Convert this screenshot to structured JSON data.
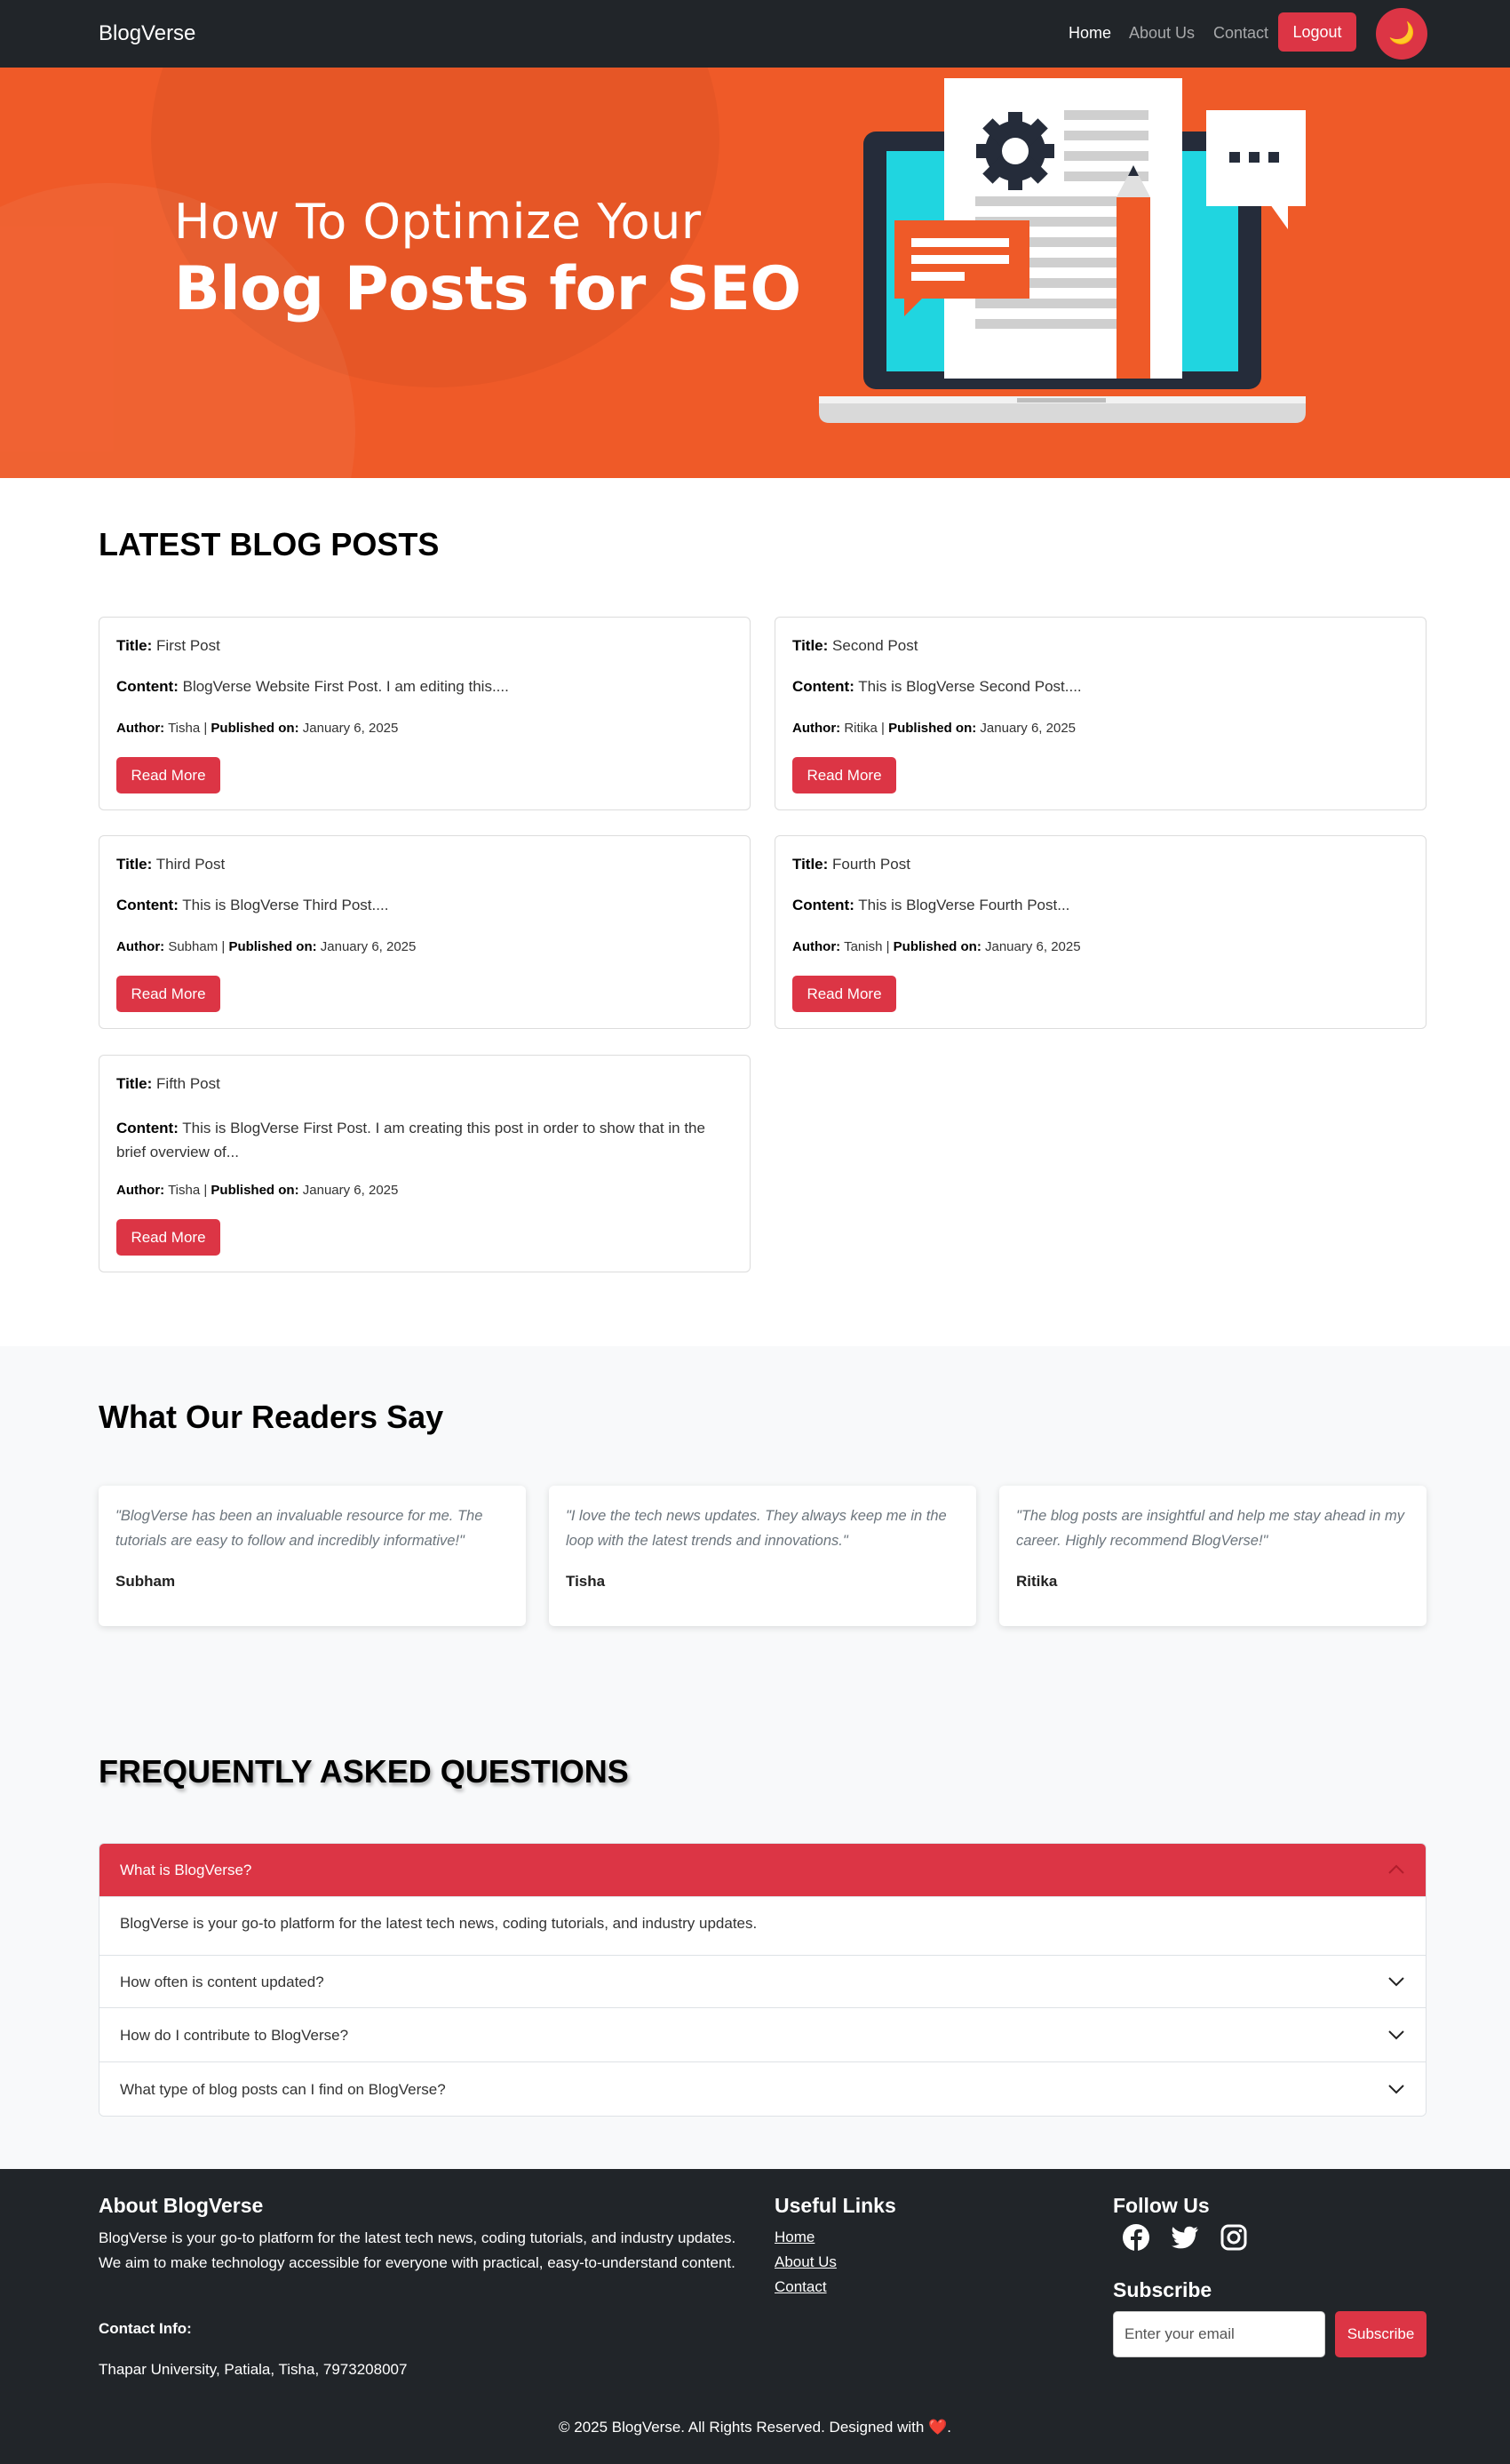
{
  "nav": {
    "brand": "BlogVerse",
    "links": [
      {
        "label": "Home",
        "active": true
      },
      {
        "label": "About Us",
        "active": false
      },
      {
        "label": "Contact",
        "active": false
      }
    ],
    "logout_label": "Logout",
    "theme_icon": "🌙"
  },
  "hero": {
    "line1": "How To Optimize Your",
    "line2": "Blog Posts for SEO"
  },
  "posts": {
    "heading": "LATEST BLOG POSTS",
    "title_label": "Title:",
    "content_label": "Content:",
    "author_label": "Author:",
    "published_label": "Published on:",
    "read_more": "Read More",
    "items": [
      {
        "title": "First Post",
        "content": "BlogVerse Website First Post. I am editing this....",
        "author": "Tisha",
        "date": "January 6, 2025"
      },
      {
        "title": "Second Post",
        "content": "This is BlogVerse Second Post....",
        "author": "Ritika",
        "date": "January 6, 2025"
      },
      {
        "title": "Third Post",
        "content": "This is BlogVerse Third Post....",
        "author": "Subham",
        "date": "January 6, 2025"
      },
      {
        "title": "Fourth Post",
        "content": "This is BlogVerse Fourth Post...",
        "author": "Tanish",
        "date": "January 6, 2025"
      },
      {
        "title": "Fifth Post",
        "content": "This is BlogVerse First Post. I am creating this post in order to show that in the brief overview of...",
        "author": "Tisha",
        "date": "January 6, 2025"
      }
    ]
  },
  "reviews": {
    "heading": "What Our Readers Say",
    "items": [
      {
        "quote": "\"BlogVerse has been an invaluable resource for me. The tutorials are easy to follow and incredibly informative!\"",
        "author": "Subham"
      },
      {
        "quote": "\"I love the tech news updates. They always keep me in the loop with the latest trends and innovations.\"",
        "author": "Tisha"
      },
      {
        "quote": "\"The blog posts are insightful and help me stay ahead in my career. Highly recommend BlogVerse!\"",
        "author": "Ritika"
      }
    ]
  },
  "faq": {
    "heading": "FREQUENTLY ASKED QUESTIONS",
    "items": [
      {
        "question": "What is BlogVerse?",
        "answer": "BlogVerse is your go-to platform for the latest tech news, coding tutorials, and industry updates.",
        "open": true
      },
      {
        "question": "How often is content updated?",
        "open": false
      },
      {
        "question": "How do I contribute to BlogVerse?",
        "open": false
      },
      {
        "question": "What type of blog posts can I find on BlogVerse?",
        "open": false
      }
    ]
  },
  "footer": {
    "about_heading": "About BlogVerse",
    "about_text": "BlogVerse is your go-to platform for the latest tech news, coding tutorials, and industry updates. We aim to make technology accessible for everyone with practical, easy-to-understand content.",
    "contact_heading": "Contact Info:",
    "contact_text": "Thapar University, Patiala, Tisha, 7973208007",
    "links_heading": "Useful Links",
    "links": [
      "Home",
      "About Us",
      "Contact"
    ],
    "follow_heading": "Follow Us",
    "social_icons": [
      "facebook-icon",
      "twitter-icon",
      "instagram-icon"
    ],
    "subscribe_heading": "Subscribe",
    "email_placeholder": "Enter your email",
    "subscribe_label": "Subscribe",
    "copyright_text": "© 2025 BlogVerse. All Rights Reserved. Designed with",
    "heart": "❤️",
    "copyright_end": "."
  },
  "colors": {
    "navbar": "#212529",
    "accent": "#dc3545",
    "hero": "#ef5a28",
    "section_bg": "#f8f9fa"
  }
}
